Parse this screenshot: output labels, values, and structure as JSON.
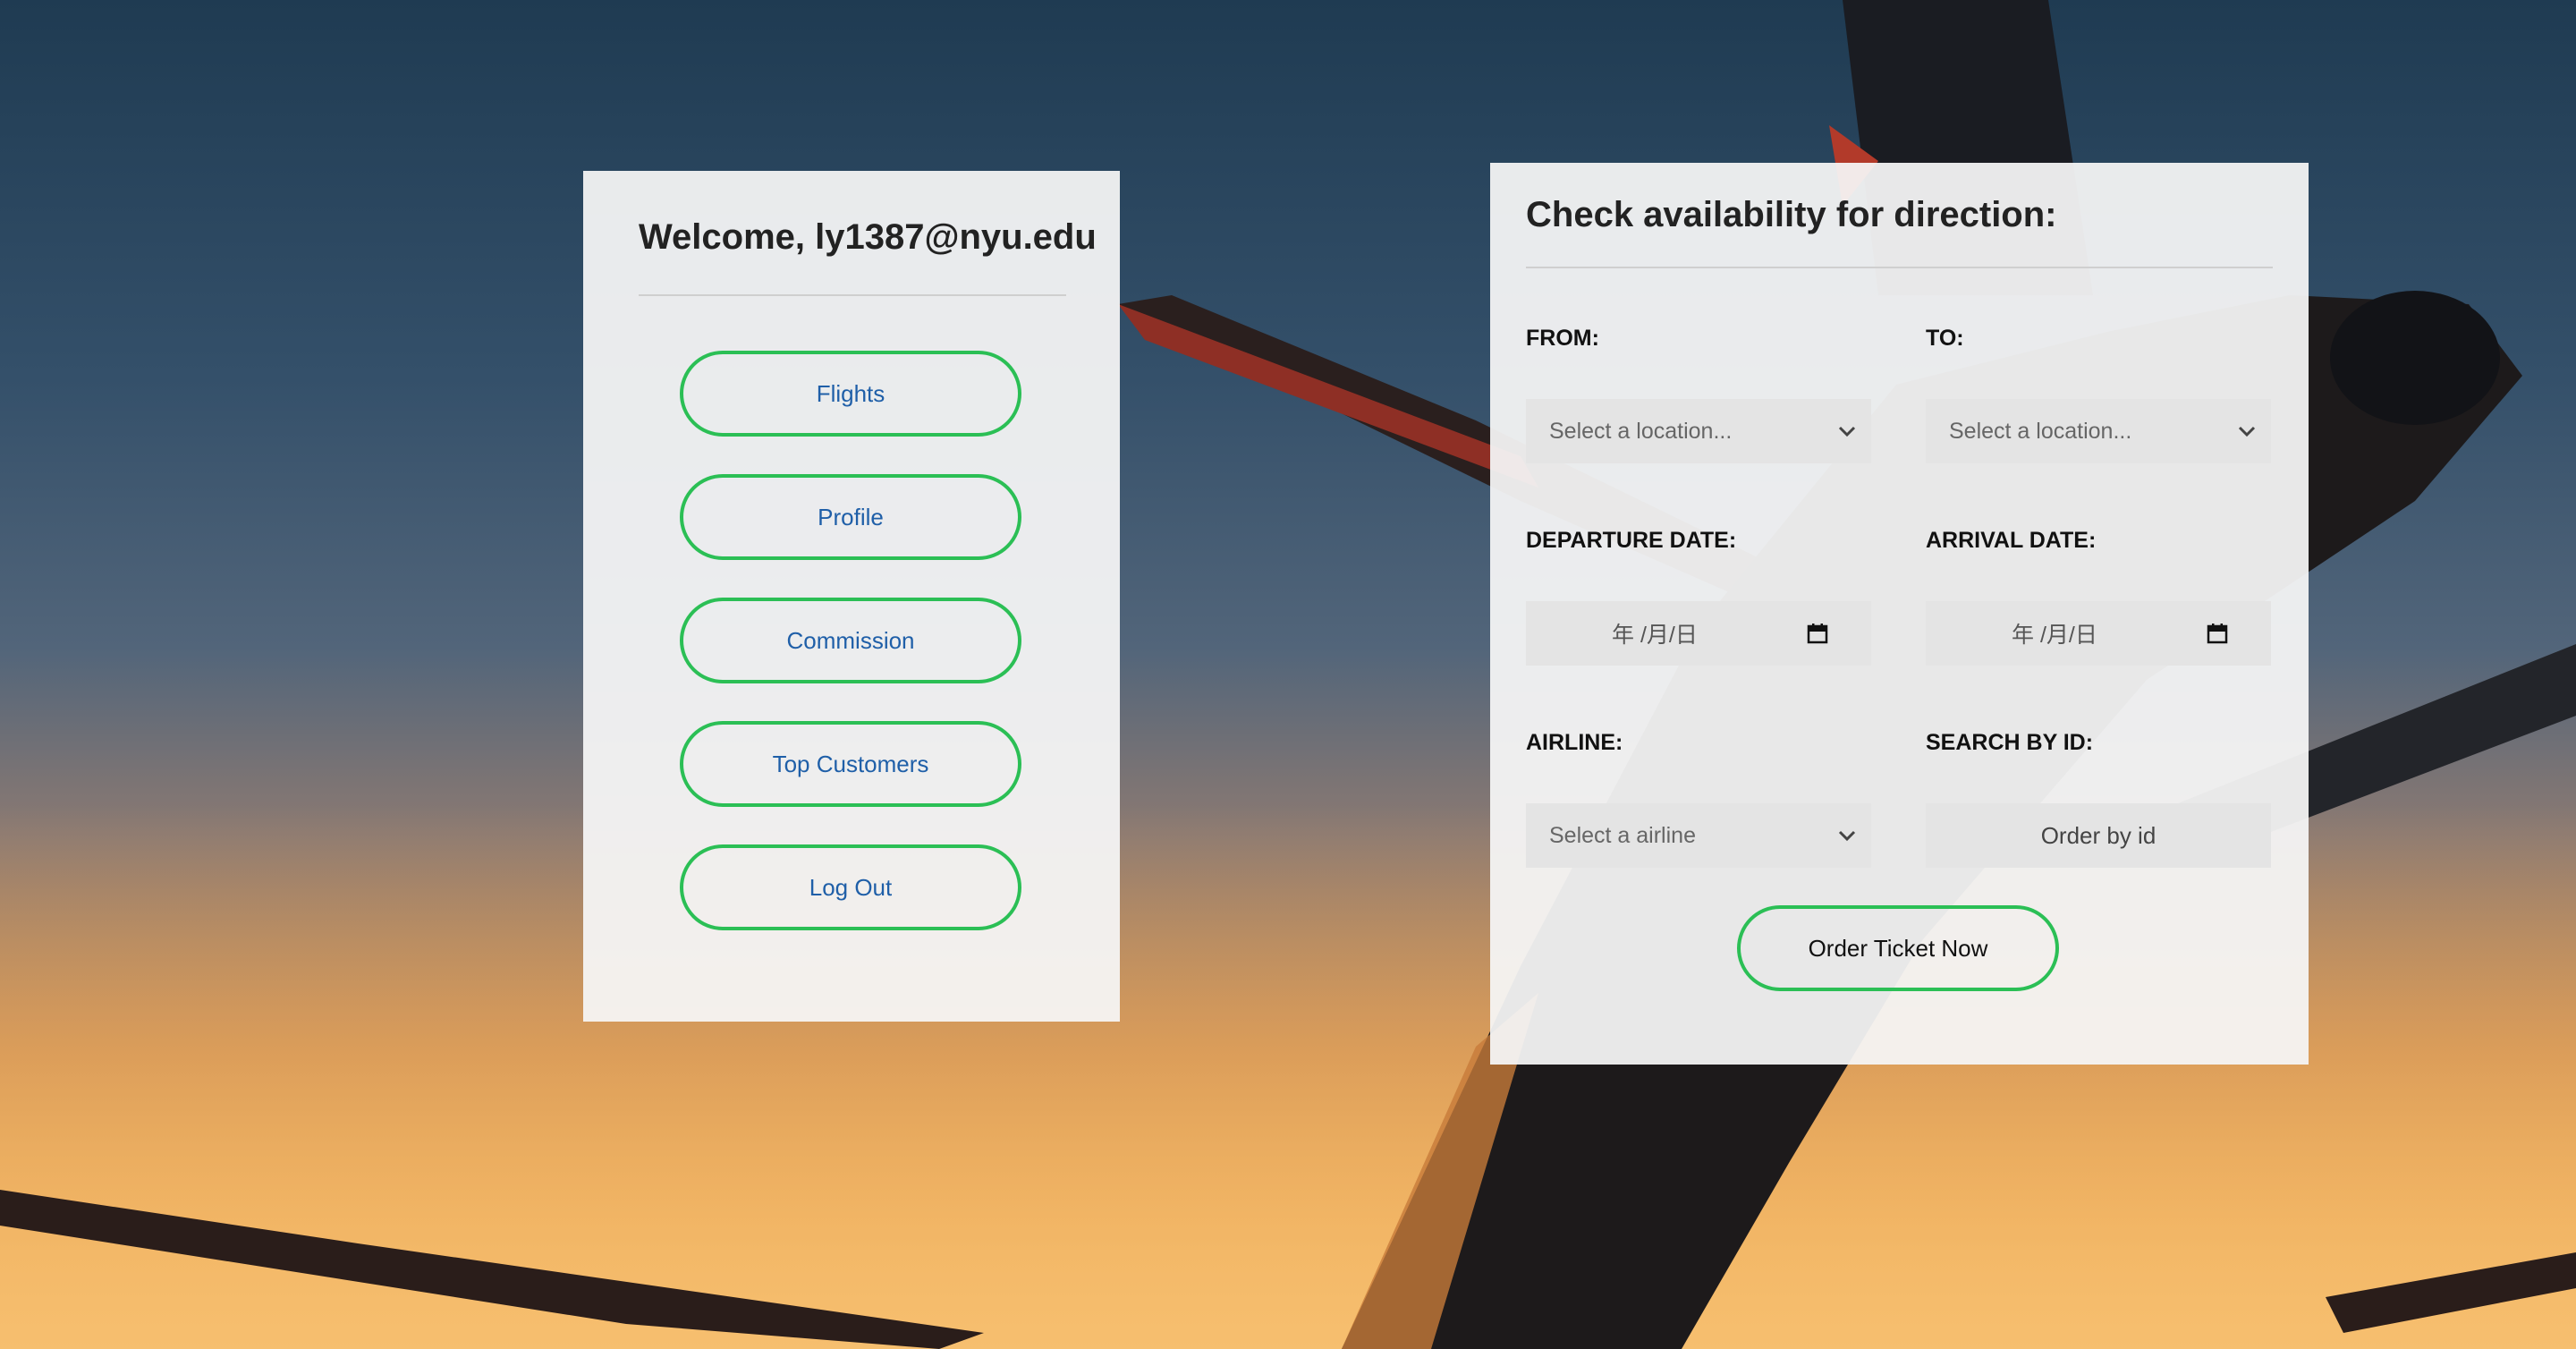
{
  "left_panel": {
    "welcome": "Welcome, ly1387@nyu.edu",
    "nav": [
      {
        "label": "Flights"
      },
      {
        "label": "Profile"
      },
      {
        "label": "Commission"
      },
      {
        "label": "Top Customers"
      },
      {
        "label": "Log Out"
      }
    ]
  },
  "right_panel": {
    "title": "Check availability for direction:",
    "from": {
      "label": "FROM:",
      "placeholder": "Select a location..."
    },
    "to": {
      "label": "TO:",
      "placeholder": "Select a location..."
    },
    "departure_date": {
      "label": "DEPARTURE DATE:",
      "placeholder": "年 /月/日"
    },
    "arrival_date": {
      "label": "ARRIVAL DATE:",
      "placeholder": "年 /月/日"
    },
    "airline": {
      "label": "AIRLINE:",
      "placeholder": "Select a airline"
    },
    "search_id": {
      "label": "SEARCH BY ID:",
      "placeholder": "Order by id"
    },
    "order_button": "Order Ticket Now"
  },
  "colors": {
    "button_border": "#2bbf55",
    "nav_text": "#1f5fa8",
    "panel_bg": "#f5f5f5"
  },
  "icons": {
    "select_arrow": "chevron-down-icon",
    "date_picker": "calendar-icon"
  }
}
